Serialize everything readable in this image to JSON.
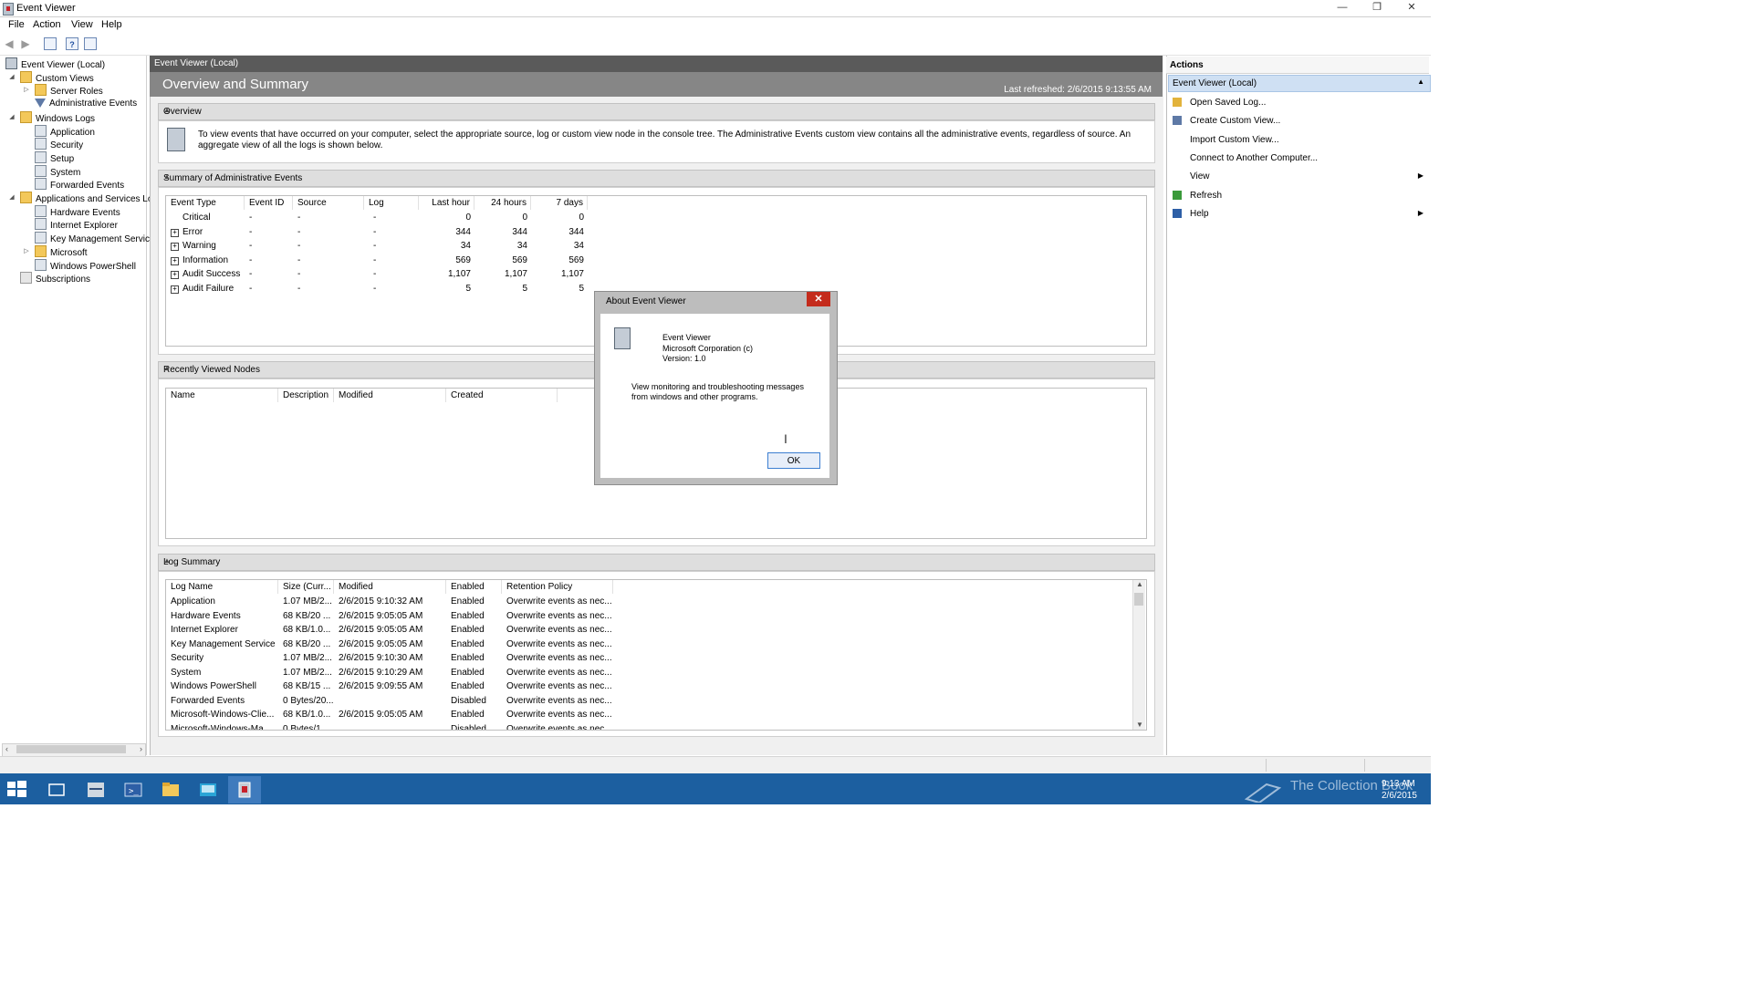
{
  "window": {
    "title": "Event Viewer",
    "min": "—",
    "restore": "❐",
    "close": "✕"
  },
  "menu": [
    "File",
    "Action",
    "View",
    "Help"
  ],
  "toolbar": {
    "back": "◀",
    "forward": "▶",
    "help": "?"
  },
  "tree": [
    {
      "label": "Event Viewer (Local)",
      "icon": "event-viewer-icon",
      "twisty": ""
    },
    {
      "label": "Custom Views",
      "icon": "folder-icon",
      "twisty": "◢"
    },
    {
      "label": "Server Roles",
      "icon": "folder-icon",
      "twisty": "▷"
    },
    {
      "label": "Administrative Events",
      "icon": "filter-icon",
      "twisty": ""
    },
    {
      "label": "Windows Logs",
      "icon": "folder-icon",
      "twisty": "◢"
    },
    {
      "label": "Application",
      "icon": "log-icon",
      "twisty": ""
    },
    {
      "label": "Security",
      "icon": "log-icon",
      "twisty": ""
    },
    {
      "label": "Setup",
      "icon": "log-icon",
      "twisty": ""
    },
    {
      "label": "System",
      "icon": "log-icon",
      "twisty": ""
    },
    {
      "label": "Forwarded Events",
      "icon": "log-icon",
      "twisty": ""
    },
    {
      "label": "Applications and Services Lo",
      "icon": "folder-icon",
      "twisty": "◢"
    },
    {
      "label": "Hardware Events",
      "icon": "log-icon",
      "twisty": ""
    },
    {
      "label": "Internet Explorer",
      "icon": "log-icon",
      "twisty": ""
    },
    {
      "label": "Key Management Service",
      "icon": "log-icon",
      "twisty": ""
    },
    {
      "label": "Microsoft",
      "icon": "folder-icon",
      "twisty": "▷"
    },
    {
      "label": "Windows PowerShell",
      "icon": "log-icon",
      "twisty": ""
    },
    {
      "label": "Subscriptions",
      "icon": "subscriptions-icon",
      "twisty": ""
    }
  ],
  "main": {
    "breadcrumb": "Event Viewer (Local)",
    "title": "Overview and Summary",
    "last_refreshed": "Last refreshed: 2/6/2015 9:13:55 AM",
    "overview": {
      "header": "Overview",
      "text": "To view events that have occurred on your computer, select the appropriate source, log or custom view node in the console tree. The Administrative Events custom view contains all the administrative events, regardless of source. An aggregate view of all the logs is shown below."
    },
    "summary": {
      "header": "Summary of Administrative Events",
      "columns": [
        "Event Type",
        "Event ID",
        "Source",
        "Log",
        "Last hour",
        "24 hours",
        "7 days"
      ],
      "rows": [
        {
          "expand": "",
          "type": "Critical",
          "id": "-",
          "source": "-",
          "log": "-",
          "hour": "0",
          "day": "0",
          "week": "0"
        },
        {
          "expand": "+",
          "type": "Error",
          "id": "-",
          "source": "-",
          "log": "-",
          "hour": "344",
          "day": "344",
          "week": "344"
        },
        {
          "expand": "+",
          "type": "Warning",
          "id": "-",
          "source": "-",
          "log": "-",
          "hour": "34",
          "day": "34",
          "week": "34"
        },
        {
          "expand": "+",
          "type": "Information",
          "id": "-",
          "source": "-",
          "log": "-",
          "hour": "569",
          "day": "569",
          "week": "569"
        },
        {
          "expand": "+",
          "type": "Audit Success",
          "id": "-",
          "source": "-",
          "log": "-",
          "hour": "1,107",
          "day": "1,107",
          "week": "1,107"
        },
        {
          "expand": "+",
          "type": "Audit Failure",
          "id": "-",
          "source": "-",
          "log": "-",
          "hour": "5",
          "day": "5",
          "week": "5"
        }
      ]
    },
    "recent": {
      "header": "Recently Viewed Nodes",
      "columns": [
        "Name",
        "Description",
        "Modified",
        "Created"
      ]
    },
    "log_summary": {
      "header": "Log Summary",
      "columns": [
        "Log Name",
        "Size (Curr...",
        "Modified",
        "Enabled",
        "Retention Policy"
      ],
      "rows": [
        {
          "name": "Application",
          "size": "1.07 MB/2...",
          "modified": "2/6/2015 9:10:32 AM",
          "enabled": "Enabled",
          "policy": "Overwrite events as nec..."
        },
        {
          "name": "Hardware Events",
          "size": "68 KB/20 ...",
          "modified": "2/6/2015 9:05:05 AM",
          "enabled": "Enabled",
          "policy": "Overwrite events as nec..."
        },
        {
          "name": "Internet Explorer",
          "size": "68 KB/1.0...",
          "modified": "2/6/2015 9:05:05 AM",
          "enabled": "Enabled",
          "policy": "Overwrite events as nec..."
        },
        {
          "name": "Key Management Service",
          "size": "68 KB/20 ...",
          "modified": "2/6/2015 9:05:05 AM",
          "enabled": "Enabled",
          "policy": "Overwrite events as nec..."
        },
        {
          "name": "Security",
          "size": "1.07 MB/2...",
          "modified": "2/6/2015 9:10:30 AM",
          "enabled": "Enabled",
          "policy": "Overwrite events as nec..."
        },
        {
          "name": "System",
          "size": "1.07 MB/2...",
          "modified": "2/6/2015 9:10:29 AM",
          "enabled": "Enabled",
          "policy": "Overwrite events as nec..."
        },
        {
          "name": "Windows PowerShell",
          "size": "68 KB/15 ...",
          "modified": "2/6/2015 9:09:55 AM",
          "enabled": "Enabled",
          "policy": "Overwrite events as nec..."
        },
        {
          "name": "Forwarded Events",
          "size": "0 Bytes/20...",
          "modified": "",
          "enabled": "Disabled",
          "policy": "Overwrite events as nec..."
        },
        {
          "name": "Microsoft-Windows-Clie...",
          "size": "68 KB/1.0...",
          "modified": "2/6/2015 9:05:05 AM",
          "enabled": "Enabled",
          "policy": "Overwrite events as nec..."
        },
        {
          "name": "Microsoft-Windows-Ma...",
          "size": "0 Bytes/1...",
          "modified": "",
          "enabled": "Disabled",
          "policy": "Overwrite events as nec..."
        }
      ]
    }
  },
  "actions": {
    "header": "Actions",
    "selected": "Event Viewer (Local)",
    "items": [
      {
        "label": "Open Saved Log...",
        "icon": "open-log-icon",
        "submenu": ""
      },
      {
        "label": "Create Custom View...",
        "icon": "filter-icon",
        "submenu": ""
      },
      {
        "label": "Import Custom View...",
        "icon": "",
        "submenu": ""
      },
      {
        "label": "Connect to Another Computer...",
        "icon": "",
        "submenu": ""
      },
      {
        "label": "View",
        "icon": "",
        "submenu": "▶"
      },
      {
        "label": "Refresh",
        "icon": "refresh-icon",
        "submenu": ""
      },
      {
        "label": "Help",
        "icon": "help-icon",
        "submenu": "▶"
      }
    ]
  },
  "dialog": {
    "title": "About Event Viewer",
    "close": "✕",
    "app_name": "Event Viewer",
    "company": "Microsoft Corporation (c)",
    "version": "Version: 1.0",
    "description_line1": "View monitoring and troubleshooting messages",
    "description_line2": "from windows and other programs.",
    "ok": "OK"
  },
  "taskbar": {
    "clock_time": "9:13 AM",
    "clock_date": "2/6/2015",
    "watermark": "The Collection Book"
  },
  "colors": {
    "taskbar": "#1c5fa0",
    "header_bar": "#868686",
    "breadcrumb": "#5a5a5a",
    "selected_action": "#cfe0f3",
    "close_red": "#c42b1c"
  }
}
